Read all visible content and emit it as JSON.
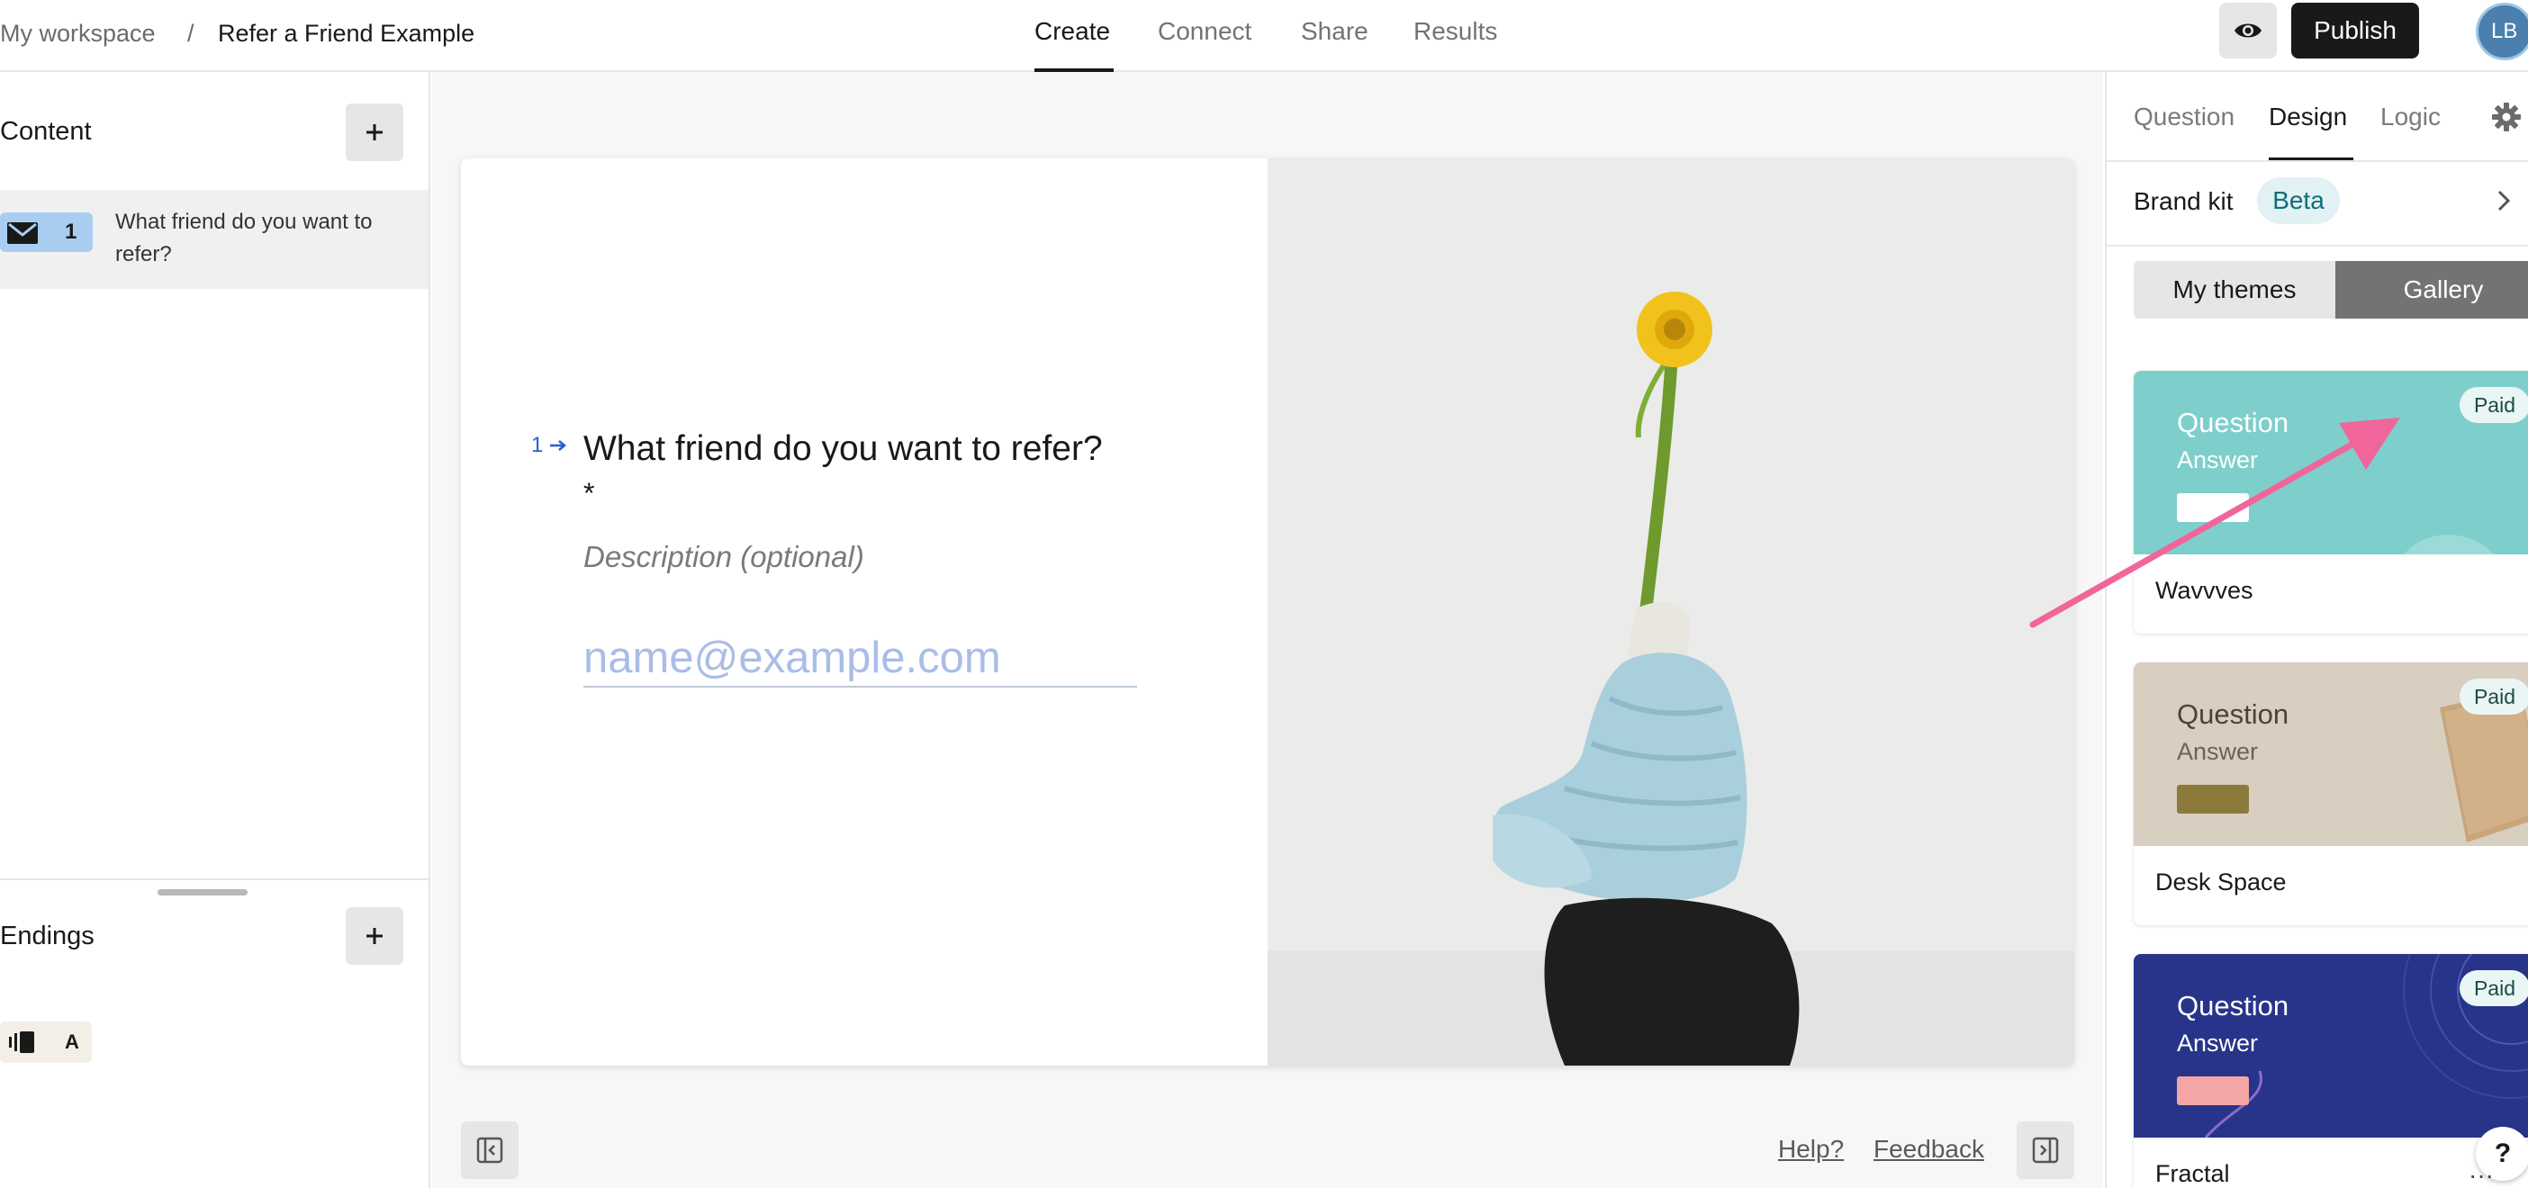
{
  "breadcrumb": {
    "workspace": "My workspace",
    "separator": "/",
    "form_title": "Refer a Friend Example"
  },
  "nav": {
    "tabs": [
      {
        "label": "Create",
        "active": true
      },
      {
        "label": "Connect",
        "active": false
      },
      {
        "label": "Share",
        "active": false
      },
      {
        "label": "Results",
        "active": false
      }
    ]
  },
  "header": {
    "preview_icon": "eye-icon",
    "publish_label": "Publish",
    "avatar_initials": "LB"
  },
  "left_panel": {
    "content_title": "Content",
    "question_item": {
      "icon": "envelope-icon",
      "number": "1",
      "text": "What friend do you want to refer?"
    },
    "endings_title": "Endings",
    "ending_item": {
      "icon": "ending-screen-icon",
      "letter": "A"
    }
  },
  "canvas": {
    "question_number": "1",
    "question_title": "What friend do you want to refer?",
    "required_marker": "*",
    "description_placeholder": "Description (optional)",
    "input_placeholder": "name@example.com",
    "footer": {
      "help": "Help?",
      "feedback": "Feedback"
    }
  },
  "right_panel": {
    "tabs": [
      {
        "label": "Question",
        "active": false
      },
      {
        "label": "Design",
        "active": true
      },
      {
        "label": "Logic",
        "active": false
      }
    ],
    "brand_kit_label": "Brand kit",
    "beta_badge": "Beta",
    "theme_toggle": {
      "my_themes": "My themes",
      "gallery": "Gallery",
      "selected": "Gallery"
    },
    "themes": [
      {
        "name": "Wavvves",
        "question": "Question",
        "answer": "Answer",
        "badge": "Paid",
        "bg": "#7ecfcc",
        "text_color": "#ffffff",
        "button_color": "#ffffff"
      },
      {
        "name": "Desk Space",
        "question": "Question",
        "answer": "Answer",
        "badge": "Paid",
        "bg": "#d8cfc1",
        "text_color": "#4a4438",
        "button_color": "#8c7a3c"
      },
      {
        "name": "Fractal",
        "question": "Question",
        "answer": "Answer",
        "badge": "Paid",
        "bg": "#27348a",
        "text_color": "#ffffff",
        "button_color": "#f4a6a6"
      }
    ],
    "help_bubble": "?"
  },
  "colors": {
    "accent_dark": "#191919",
    "arrow_pink": "#f0669a",
    "question_badge_blue": "#a9cdf0",
    "input_placeholder": "#a9bde6"
  }
}
